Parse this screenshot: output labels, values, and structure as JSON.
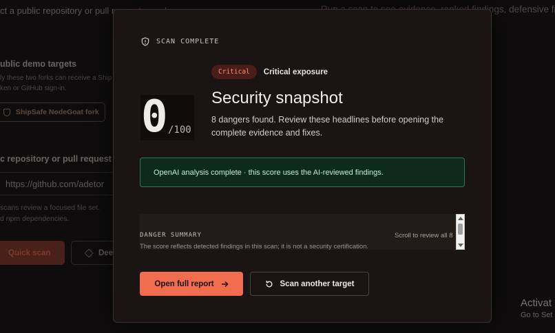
{
  "background": {
    "top_left_text": "ct a public repository or pull request or a demo scan",
    "top_right_text": "Run a scan to see evidence, ranked findings, defensive fix",
    "demo_heading": "ublic demo targets",
    "demo_sub_line1": "ly these two forks can receive a Ship",
    "demo_sub_line2": "ken or GitHub sign-in.",
    "fork_button": "ShipSafe NodeGoat fork",
    "repo_heading": "c repository or pull request",
    "repo_input_value": "https://github.com/adetor",
    "note_line1": "scans review a focused file set.",
    "note_line2": "d npm dependencies.",
    "quick_scan_label": "Quick scan",
    "deep_scan_label": "Dee",
    "activate_title": "Activat",
    "activate_sub": "Go to Set"
  },
  "modal": {
    "eyebrow": "SCAN COMPLETE",
    "score": "0",
    "score_max": "/100",
    "severity_badge": "Critical",
    "severity_label": "Critical exposure",
    "title": "Security snapshot",
    "description": "8 dangers found. Review these headlines before opening the complete evidence and fixes.",
    "ai_notice": "OpenAI analysis complete · this score uses the AI-reviewed findings.",
    "danger_summary": {
      "heading": "DANGER SUMMARY",
      "hint": "Scroll to review all 8",
      "note": "The score reflects detected findings in this scan; it is not a security certification."
    },
    "actions": {
      "open_report": "Open full report",
      "scan_another": "Scan another target"
    }
  },
  "colors": {
    "accent": "#f26c4f",
    "critical_badge_bg": "#4a1c1a",
    "critical_badge_text": "#ff8f7a",
    "success_bg": "#0e2a1d",
    "success_border": "#2f7a55"
  },
  "icons": {
    "eyebrow": "shield-icon",
    "open_report": "arrow-right-icon",
    "scan_another": "refresh-icon"
  }
}
